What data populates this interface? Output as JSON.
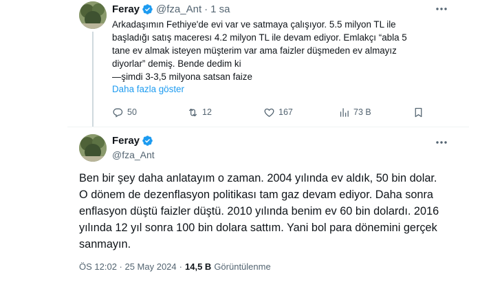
{
  "parent_tweet": {
    "display_name": "Feray",
    "handle": "@fza_Ant",
    "separator": "·",
    "time_ago": "1 sa",
    "lines": [
      "Arkadaşımın Fethiye'de evi var ve satmaya çalışıyor. 5.5 milyon TL ile",
      "başladığı satış maceresı 4.2 milyon TL ile devam ediyor. Emlakçı “abla 5",
      "tane ev almak isteyen müşterim var ama faizler düşmeden ev almayız",
      "diyorlar” demiş.  Bende dedim ki",
      "—şimdi 3-3,5 milyona satsan faize"
    ],
    "show_more": "Daha fazla göster",
    "actions": {
      "replies": "50",
      "reposts": "12",
      "likes": "167",
      "views": "73 B"
    }
  },
  "main_tweet": {
    "display_name": "Feray",
    "handle": "@fza_Ant",
    "lines": [
      "Ben bir şey daha anlatayım o zaman. 2004 yılında ev aldık, 50 bin dolar.",
      "O dönem de dezenflasyon politikası tam gaz devam ediyor. Daha sonra",
      "enflasyon düştü faizler düştü. 2010 yılında benim ev 60 bin dolardı. 2016",
      "yılında 12 yıl sonra  100 bin dolara sattım. Yani bol para dönemini gerçek",
      "sanmayın."
    ],
    "timestamp": "ÖS 12:02 · 25 May 2024",
    "separator": "·",
    "views_count": "14,5 B",
    "views_label": "Görüntülenme"
  },
  "colors": {
    "accent": "#1d9bf0",
    "text": "#0f1419",
    "muted": "#536471",
    "divider": "#eff3f4"
  },
  "icons": {
    "verified": "verified-badge-icon",
    "more": "more-dots-icon",
    "reply": "reply-bubble-icon",
    "repost": "repost-arrows-icon",
    "like": "heart-icon",
    "views": "bar-chart-icon",
    "bookmark": "bookmark-icon"
  }
}
